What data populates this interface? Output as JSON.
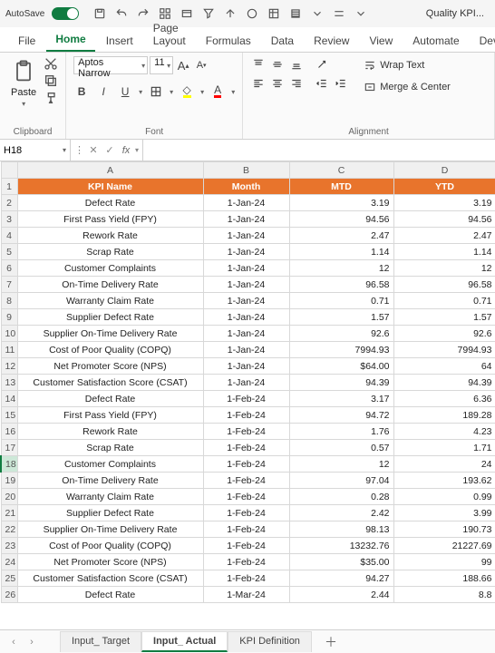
{
  "titlebar": {
    "autosave": "AutoSave",
    "filename": "Quality KPI..."
  },
  "ribbon_tabs": [
    "File",
    "Home",
    "Insert",
    "Page Layout",
    "Formulas",
    "Data",
    "Review",
    "View",
    "Automate",
    "Deve"
  ],
  "active_tab_index": 1,
  "ribbon": {
    "clipboard": {
      "paste": "Paste",
      "label": "Clipboard"
    },
    "font": {
      "name": "Aptos Narrow",
      "size": "11",
      "label": "Font"
    },
    "alignment": {
      "wrap": "Wrap Text",
      "merge": "Merge & Center",
      "label": "Alignment"
    }
  },
  "fx": {
    "cellref": "H18",
    "formula": ""
  },
  "columns": [
    "A",
    "B",
    "C",
    "D"
  ],
  "header_row": [
    "KPI Name",
    "Month",
    "MTD",
    "YTD"
  ],
  "rows": [
    {
      "n": 2,
      "a": "Defect Rate",
      "b": "1-Jan-24",
      "c": "3.19",
      "d": "3.19"
    },
    {
      "n": 3,
      "a": "First Pass Yield (FPY)",
      "b": "1-Jan-24",
      "c": "94.56",
      "d": "94.56"
    },
    {
      "n": 4,
      "a": "Rework Rate",
      "b": "1-Jan-24",
      "c": "2.47",
      "d": "2.47"
    },
    {
      "n": 5,
      "a": "Scrap Rate",
      "b": "1-Jan-24",
      "c": "1.14",
      "d": "1.14"
    },
    {
      "n": 6,
      "a": "Customer Complaints",
      "b": "1-Jan-24",
      "c": "12",
      "d": "12"
    },
    {
      "n": 7,
      "a": "On-Time Delivery Rate",
      "b": "1-Jan-24",
      "c": "96.58",
      "d": "96.58"
    },
    {
      "n": 8,
      "a": "Warranty Claim Rate",
      "b": "1-Jan-24",
      "c": "0.71",
      "d": "0.71"
    },
    {
      "n": 9,
      "a": "Supplier Defect Rate",
      "b": "1-Jan-24",
      "c": "1.57",
      "d": "1.57"
    },
    {
      "n": 10,
      "a": "Supplier On-Time Delivery Rate",
      "b": "1-Jan-24",
      "c": "92.6",
      "d": "92.6"
    },
    {
      "n": 11,
      "a": "Cost of Poor Quality (COPQ)",
      "b": "1-Jan-24",
      "c": "7994.93",
      "d": "7994.93"
    },
    {
      "n": 12,
      "a": "Net Promoter Score (NPS)",
      "b": "1-Jan-24",
      "c": "$64.00",
      "d": "64"
    },
    {
      "n": 13,
      "a": "Customer Satisfaction Score (CSAT)",
      "b": "1-Jan-24",
      "c": "94.39",
      "d": "94.39"
    },
    {
      "n": 14,
      "a": "Defect Rate",
      "b": "1-Feb-24",
      "c": "3.17",
      "d": "6.36"
    },
    {
      "n": 15,
      "a": "First Pass Yield (FPY)",
      "b": "1-Feb-24",
      "c": "94.72",
      "d": "189.28"
    },
    {
      "n": 16,
      "a": "Rework Rate",
      "b": "1-Feb-24",
      "c": "1.76",
      "d": "4.23"
    },
    {
      "n": 17,
      "a": "Scrap Rate",
      "b": "1-Feb-24",
      "c": "0.57",
      "d": "1.71"
    },
    {
      "n": 18,
      "a": "Customer Complaints",
      "b": "1-Feb-24",
      "c": "12",
      "d": "24"
    },
    {
      "n": 19,
      "a": "On-Time Delivery Rate",
      "b": "1-Feb-24",
      "c": "97.04",
      "d": "193.62"
    },
    {
      "n": 20,
      "a": "Warranty Claim Rate",
      "b": "1-Feb-24",
      "c": "0.28",
      "d": "0.99"
    },
    {
      "n": 21,
      "a": "Supplier Defect Rate",
      "b": "1-Feb-24",
      "c": "2.42",
      "d": "3.99"
    },
    {
      "n": 22,
      "a": "Supplier On-Time Delivery Rate",
      "b": "1-Feb-24",
      "c": "98.13",
      "d": "190.73"
    },
    {
      "n": 23,
      "a": "Cost of Poor Quality (COPQ)",
      "b": "1-Feb-24",
      "c": "13232.76",
      "d": "21227.69"
    },
    {
      "n": 24,
      "a": "Net Promoter Score (NPS)",
      "b": "1-Feb-24",
      "c": "$35.00",
      "d": "99"
    },
    {
      "n": 25,
      "a": "Customer Satisfaction Score (CSAT)",
      "b": "1-Feb-24",
      "c": "94.27",
      "d": "188.66"
    },
    {
      "n": 26,
      "a": "Defect Rate",
      "b": "1-Mar-24",
      "c": "2.44",
      "d": "8.8"
    }
  ],
  "selected_row": 18,
  "sheet_tabs": [
    "Input_ Target",
    "Input_ Actual",
    "KPI Definition"
  ],
  "active_sheet_index": 1
}
